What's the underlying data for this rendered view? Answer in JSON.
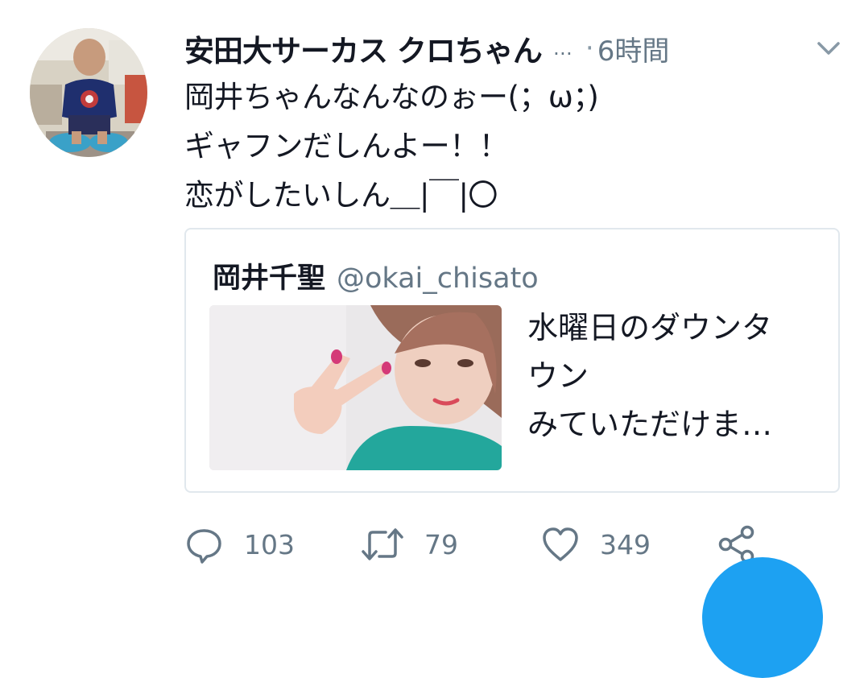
{
  "tweet": {
    "display_name": "安田大サーカス クロちゃん",
    "name_truncation": "…",
    "separator": "·",
    "time": "6時間",
    "lines": [
      "岡井ちゃんなんなのぉー(；ω；)",
      "ギャフンだしんよー！！",
      "恋がしたいしん＿|￣|〇"
    ]
  },
  "quote": {
    "name": "岡井千聖",
    "handle": "@okai_chisato",
    "text_lines": [
      "水曜日のダウンタ",
      "ウン",
      "みていただけま…"
    ]
  },
  "actions": {
    "replies": "103",
    "retweets": "79",
    "likes": "349"
  },
  "icons": {
    "reply": "reply-icon",
    "retweet": "retweet-icon",
    "like": "heart-icon",
    "share": "share-icon",
    "menu": "chevron-down-icon"
  },
  "colors": {
    "text": "#141823",
    "secondary": "#657786",
    "border": "#e1e8ed",
    "accent": "#1da1f2"
  }
}
